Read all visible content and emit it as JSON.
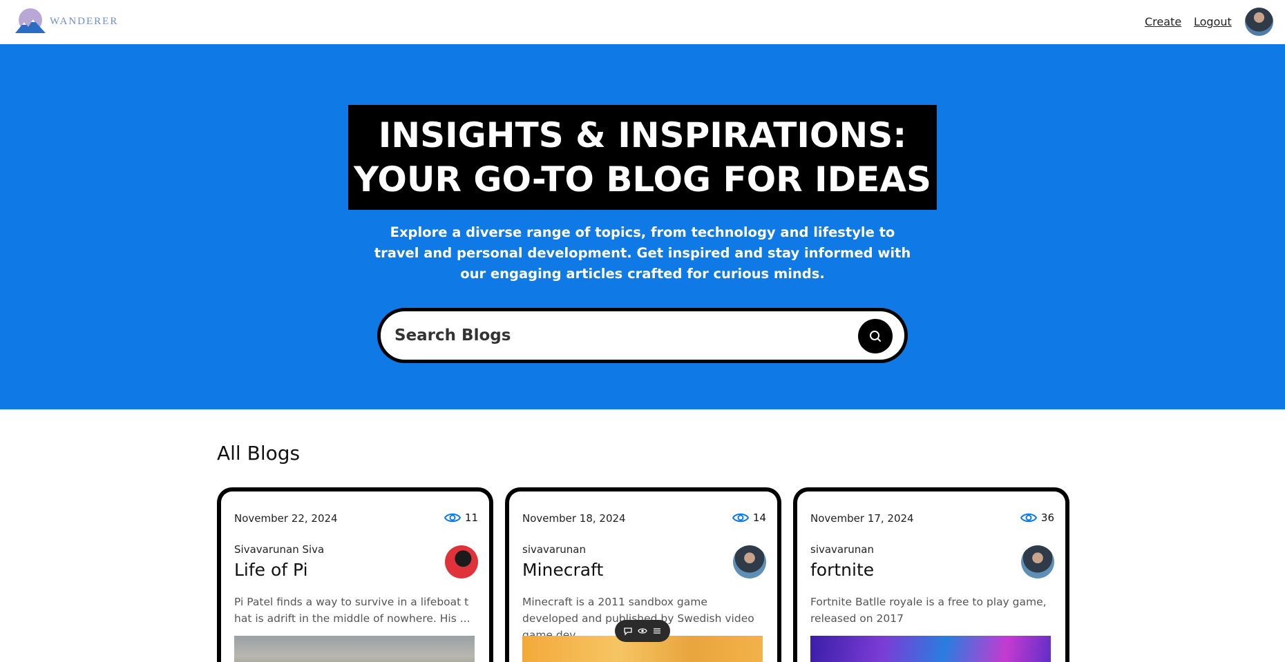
{
  "header": {
    "logo_text": "WANDERER",
    "nav": {
      "create": "Create",
      "logout": "Logout"
    }
  },
  "hero": {
    "title_line1": "INSIGHTS & INSPIRATIONS:",
    "title_line2": "YOUR GO-TO BLOG FOR IDEAS",
    "subtitle": "Explore a diverse range of topics, from technology and lifestyle to travel and personal development. Get inspired and stay informed with our engaging articles crafted for curious minds.",
    "search_placeholder": "Search Blogs"
  },
  "blogs": {
    "section_title": "All Blogs",
    "cards": [
      {
        "date": "November 22, 2024",
        "views": "11",
        "author": "Sivavarunan Siva",
        "title": "Life of Pi",
        "excerpt": "Pi Patel finds a way to survive in a lifeboat t hat is adrift in the middle of nowhere. His ..."
      },
      {
        "date": "November 18, 2024",
        "views": "14",
        "author": "sivavarunan",
        "title": "Minecraft",
        "excerpt": "Minecraft is a 2011 sandbox game developed and published by Swedish video game dev..."
      },
      {
        "date": "November 17, 2024",
        "views": "36",
        "author": "sivavarunan",
        "title": "fortnite",
        "excerpt": "Fortnite Batlle royale is a free to play game, released on 2017"
      }
    ]
  },
  "colors": {
    "hero_bg": "#0f7ae5",
    "accent": "#0f7ae5",
    "title_bg": "#000000"
  }
}
